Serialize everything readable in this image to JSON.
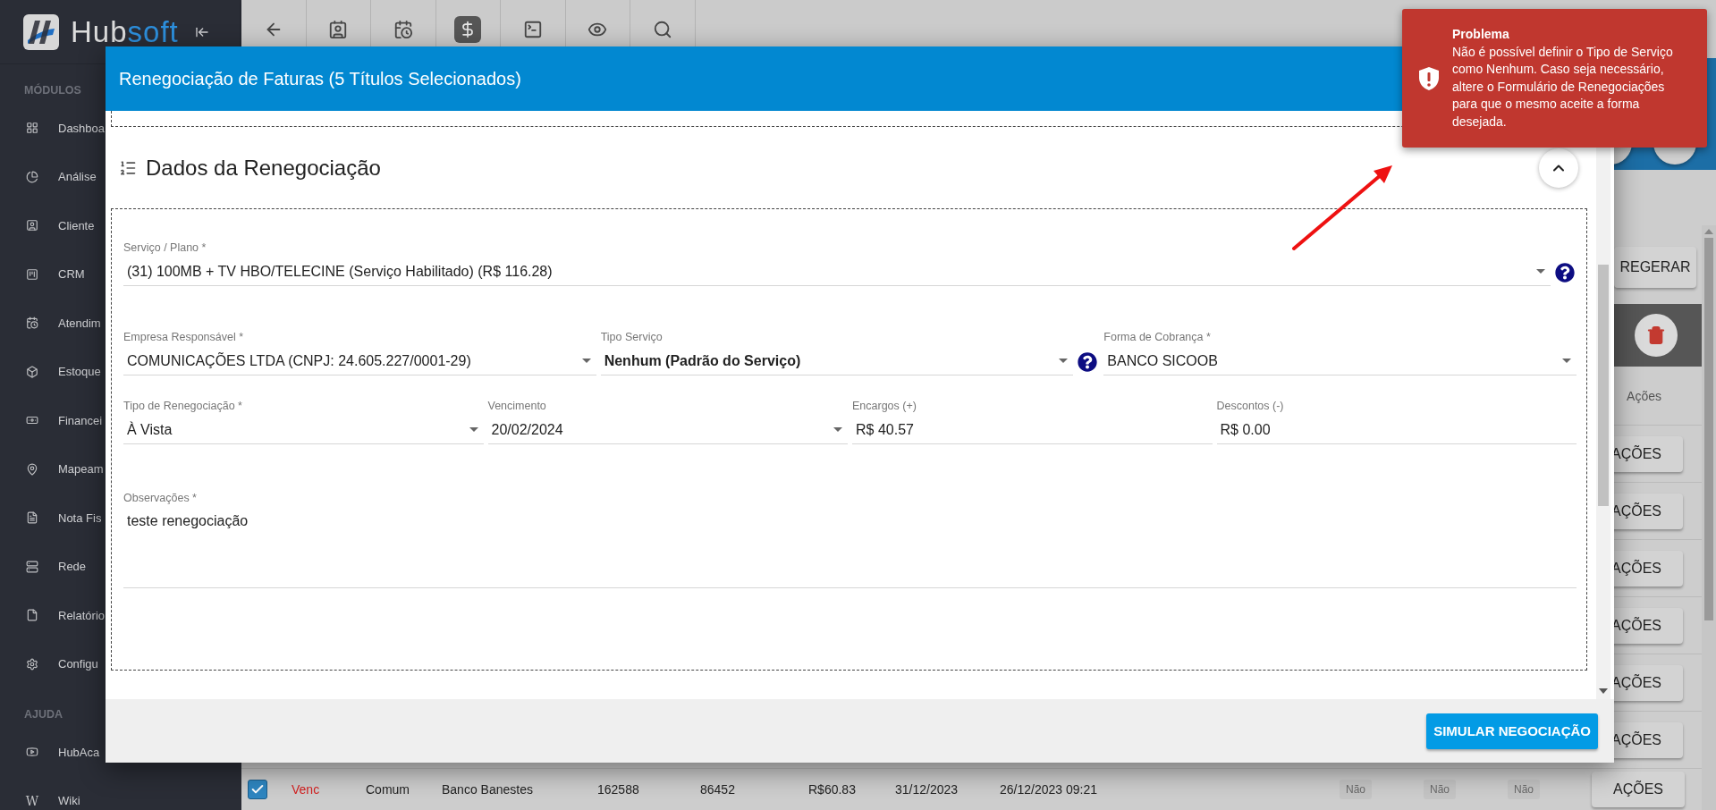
{
  "sidebar": {
    "brand": {
      "prefix": "Hub",
      "suffix": "soft"
    },
    "sections": [
      {
        "title": "MÓDULOS",
        "items": [
          {
            "label": "Dashboa"
          },
          {
            "label": "Análise"
          },
          {
            "label": "Cliente"
          },
          {
            "label": "CRM"
          },
          {
            "label": "Atendim"
          },
          {
            "label": "Estoque"
          },
          {
            "label": "Financei"
          },
          {
            "label": "Mapeam"
          },
          {
            "label": "Nota Fis"
          },
          {
            "label": "Rede"
          },
          {
            "label": "Relatório"
          },
          {
            "label": "Configu"
          }
        ]
      },
      {
        "title": "AJUDA",
        "items": [
          {
            "label": "HubAca"
          },
          {
            "label": "Wiki",
            "glyph": "W"
          }
        ]
      }
    ]
  },
  "toolbar": [
    {
      "selected": false
    },
    {
      "selected": false
    },
    {
      "selected": false
    },
    {
      "selected": true
    },
    {
      "selected": false
    },
    {
      "selected": false
    },
    {
      "selected": false
    }
  ],
  "background": {
    "reload_button": "REGERAR",
    "actions_header": "Ações",
    "action_buttons": [
      "AÇÕES",
      "AÇÕES",
      "AÇÕES",
      "AÇÕES",
      "AÇÕES",
      "AÇÕES"
    ],
    "last_row": {
      "checked": true,
      "status": "Venc",
      "cells": [
        "Comum",
        "Banco Banestes",
        "162588",
        "86452",
        "R$60.83",
        "31/12/2023",
        "26/12/2023 09:21"
      ],
      "flags": [
        {
          "label": "Não",
          "disabled": true
        },
        {
          "label": "Não",
          "disabled": true
        },
        {
          "label": "Não",
          "disabled": true
        }
      ],
      "action": "AÇÕES"
    }
  },
  "modal": {
    "title": "Renegociação de Faturas (5 Títulos Selecionados)",
    "section": {
      "title": "Dados da Renegociação",
      "expanded": true
    },
    "field_rows": [
      [
        {
          "kind": "select",
          "label": "Serviço / Plano *",
          "value": "(31) 100MB + TV HBO/TELECINE (Serviço Habilitado) (R$ 116.28)",
          "help": true,
          "emphasized": false
        }
      ],
      [
        {
          "kind": "select",
          "label": "Empresa Responsável *",
          "value": "COMUNICAÇÕES LTDA (CNPJ: 24.605.227/0001-29)",
          "help": false,
          "emphasized": false
        },
        {
          "kind": "select",
          "label": "Tipo Serviço",
          "value": "Nenhum (Padrão do Serviço)",
          "help": true,
          "emphasized": true
        },
        {
          "kind": "select",
          "label": "Forma de Cobrança *",
          "value": "BANCO SICOOB",
          "help": false,
          "emphasized": false
        }
      ],
      [
        {
          "kind": "select",
          "label": "Tipo de Renegociação *",
          "value": "À Vista",
          "help": false,
          "emphasized": false
        },
        {
          "kind": "select",
          "label": "Vencimento",
          "value": "20/02/2024",
          "help": false,
          "emphasized": false
        },
        {
          "kind": "text",
          "label": "Encargos (+)",
          "value": "R$ 40.57",
          "help": false,
          "emphasized": false
        },
        {
          "kind": "text",
          "label": "Descontos (-)",
          "value": "R$ 0.00",
          "help": false,
          "emphasized": false
        }
      ],
      [
        {
          "kind": "textarea",
          "label": "Observações *",
          "value": "teste renegociação",
          "help": false,
          "emphasized": false
        }
      ]
    ],
    "footer_button": "SIMULAR NEGOCIAÇÃO"
  },
  "toast": {
    "title": "Problema",
    "message": "Não é possível definir o Tipo de Serviço como Nenhum. Caso seja necessário, altere o Formulário de Renegociações para que o mesmo aceite a forma desejada."
  }
}
